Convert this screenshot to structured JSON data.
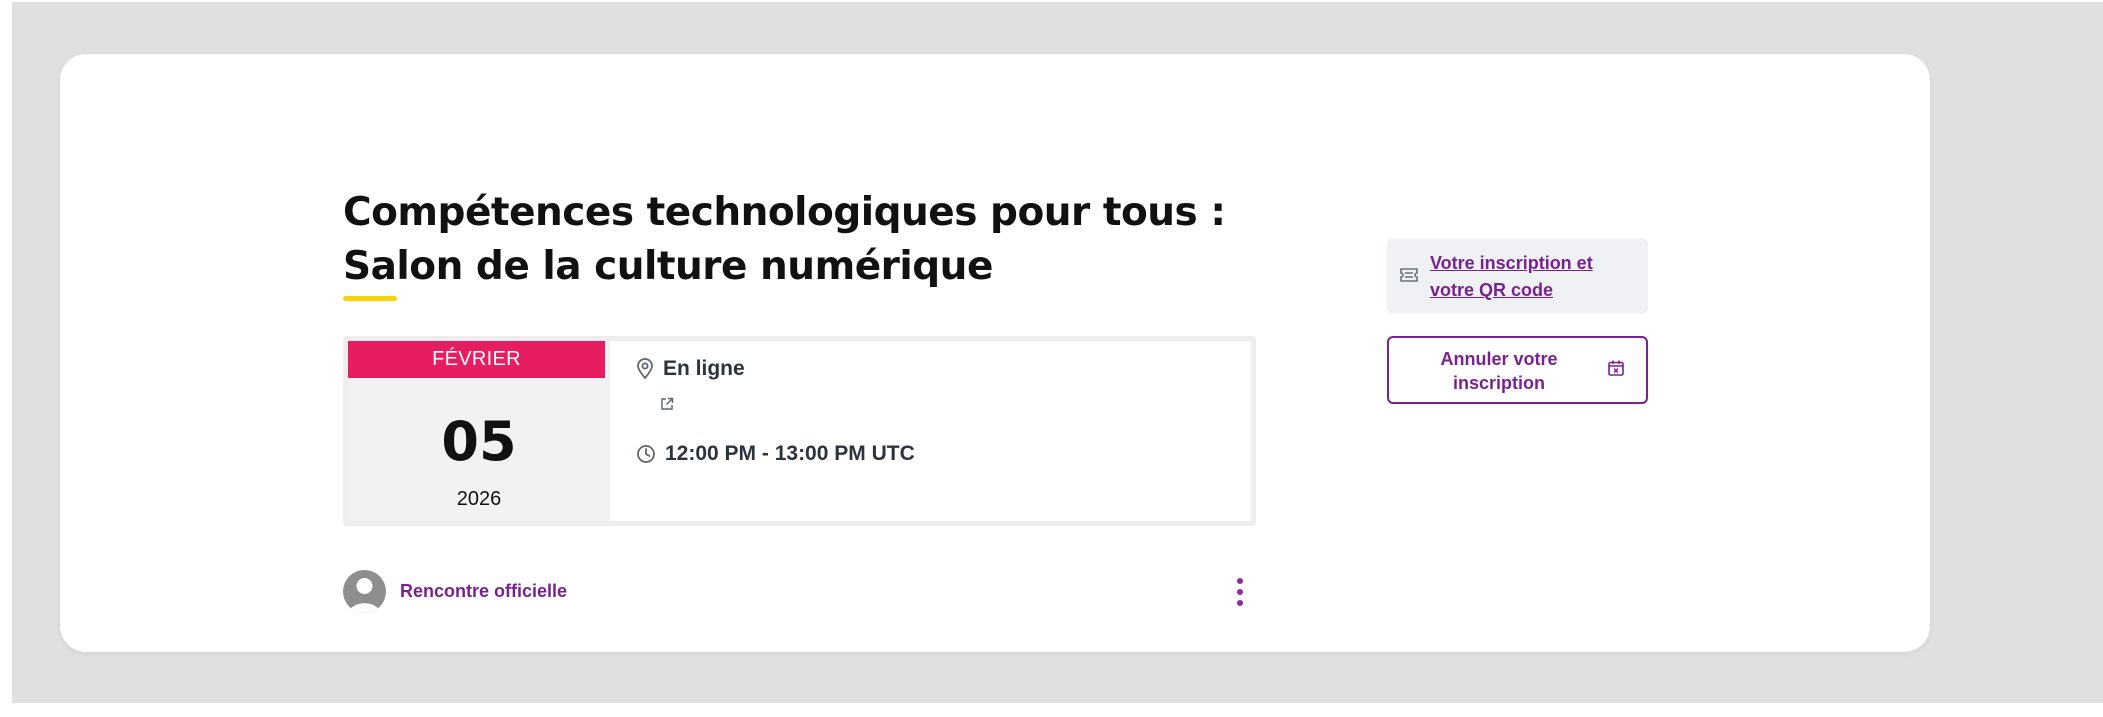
{
  "event": {
    "title": "Compétences technologiques pour tous : Salon de la culture numérique",
    "date": {
      "month": "FÉVRIER",
      "day": "05",
      "year": "2026"
    },
    "location": "En ligne",
    "time": "12:00 PM - 13:00 PM UTC"
  },
  "organizer": {
    "name": "Rencontre officielle"
  },
  "actions": {
    "registration_link": "Votre inscription et votre QR code",
    "cancel_label": "Annuler votre inscription"
  },
  "colors": {
    "accent": "#7a2191",
    "month_banner": "#e71d62",
    "title_underline": "#f5d50a"
  },
  "icons": [
    "location-pin-icon",
    "external-link-icon",
    "clock-icon",
    "ticket-icon",
    "calendar-cancel-icon",
    "more-vertical-icon"
  ]
}
